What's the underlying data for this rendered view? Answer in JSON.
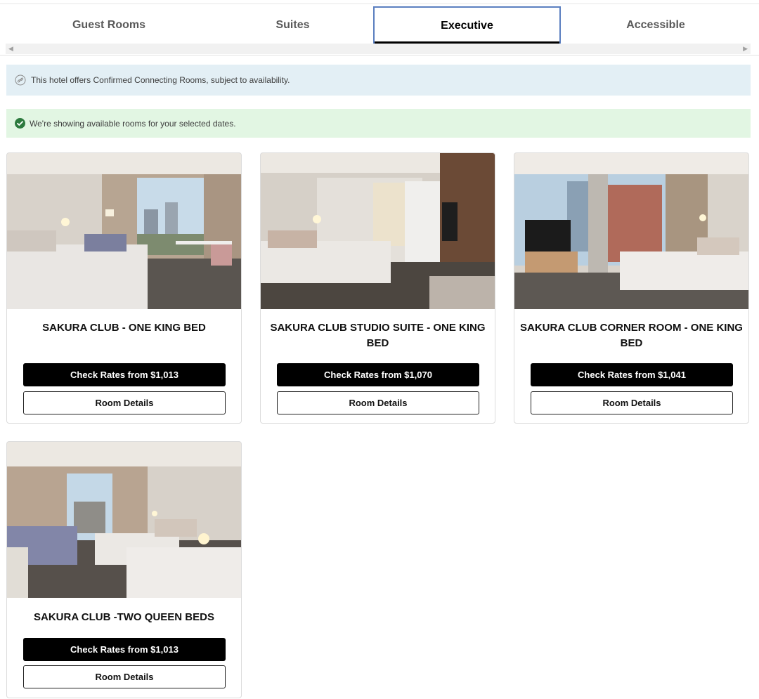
{
  "tabs": [
    {
      "label": "Guest Rooms",
      "selected": false
    },
    {
      "label": "Suites",
      "selected": false
    },
    {
      "label": "Executive",
      "selected": true
    },
    {
      "label": "Accessible",
      "selected": false
    }
  ],
  "banners": {
    "info": {
      "text": "This hotel offers Confirmed Connecting Rooms, subject to availability.",
      "icon": "link-icon"
    },
    "success": {
      "text": "We're showing available rooms for your selected dates.",
      "icon": "check-circle-icon"
    }
  },
  "rooms": [
    {
      "title": "SAKURA CLUB - ONE KING BED",
      "rates_label": "Check Rates from $1,013",
      "details_label": "Room Details"
    },
    {
      "title": "SAKURA CLUB STUDIO SUITE - ONE KING BED",
      "rates_label": "Check Rates from $1,070",
      "details_label": "Room Details"
    },
    {
      "title": "SAKURA CLUB CORNER ROOM - ONE KING BED",
      "rates_label": "Check Rates from $1,041",
      "details_label": "Room Details"
    },
    {
      "title": "SAKURA CLUB -TWO QUEEN BEDS",
      "rates_label": "Check Rates from $1,013",
      "details_label": "Room Details"
    }
  ],
  "colors": {
    "accent_tab_border": "#5b7fc0",
    "info_bg": "#e3eff5",
    "success_bg": "#e2f6e3",
    "success_icon": "#2c7a3e",
    "button_primary": "#000000"
  }
}
